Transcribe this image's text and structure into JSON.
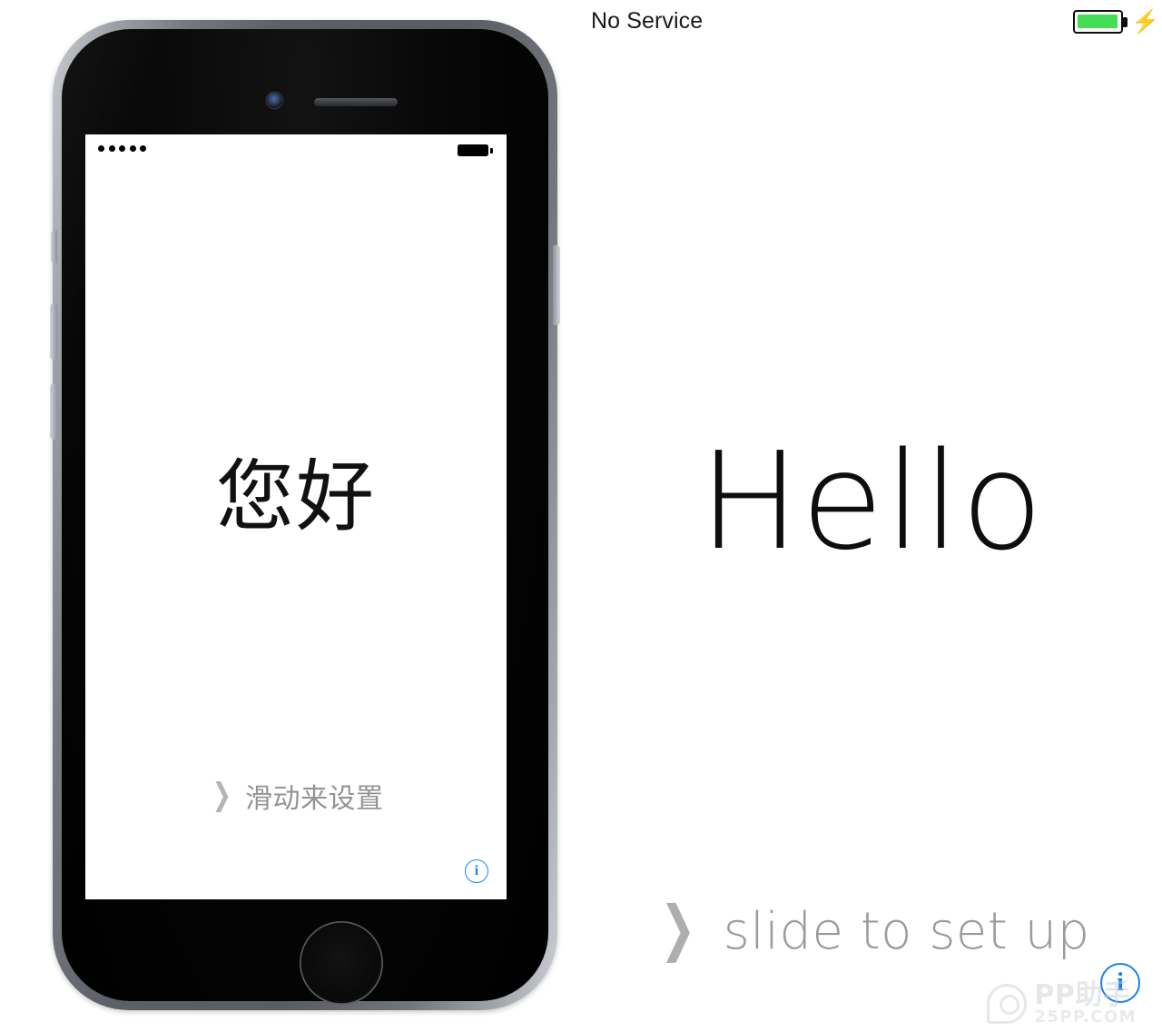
{
  "system_status_bar": {
    "carrier": "No Service",
    "battery": {
      "icon": "battery-full-icon",
      "charging_icon": "lightning-bolt-icon",
      "bolt_glyph": "⚡",
      "level_percent": 100,
      "fill_color": "#44dd55",
      "outline_color": "#0d0d0d",
      "charging": true
    }
  },
  "device": {
    "model_appearance": "iphone-space-gray",
    "frame_color": "#75797f",
    "face_color": "#060606",
    "sensors": {
      "camera": "front-camera-icon",
      "speaker": "earpiece-speaker-icon"
    },
    "buttons": {
      "silent_switch": "silent-switch",
      "volume_up": "volume-up-button",
      "volume_down": "volume-down-button",
      "power": "power-button",
      "home": "home-button"
    },
    "screen": {
      "status_bar": {
        "signal_dots": 5,
        "battery_icon": "battery-full-black-icon"
      },
      "greeting": "您好",
      "slide_chevron": "❯",
      "slide_label": "滑动来设置",
      "info_button": {
        "icon": "info-circle-icon",
        "glyph": "i",
        "color": "#1a84f7"
      }
    }
  },
  "panel": {
    "greeting": "Hello",
    "slide_chevron": "❯",
    "slide_label": "slide to set up",
    "slide_label_color": "#9b9b9b",
    "info_button": {
      "icon": "info-circle-icon",
      "glyph": "i",
      "color": "#1a7ef0"
    }
  },
  "watermark": {
    "logo": "pp-assistant-logo",
    "title": "PP助手",
    "subtitle": "25PP.COM",
    "color": "#c6c8cb"
  }
}
